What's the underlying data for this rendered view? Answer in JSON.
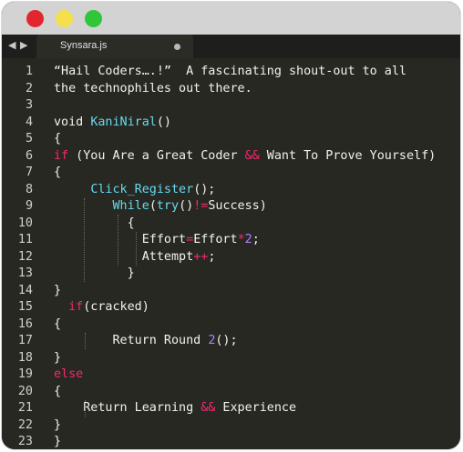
{
  "window": {
    "tab_title": "Synsara.js",
    "nav_back": "◀",
    "nav_forward": "▶",
    "colors": {
      "close": "#e3262e",
      "minimize": "#f5e04b",
      "maximize": "#31c53a",
      "background": "#272822"
    }
  },
  "editor": {
    "lines": [
      {
        "n": "1",
        "parts": [
          [
            "plain",
            "“Hail Coders….!”  A fascinating shout-out to all"
          ]
        ]
      },
      {
        "n": "2",
        "parts": [
          [
            "plain",
            "the technophiles out there."
          ]
        ]
      },
      {
        "n": "3",
        "parts": [
          [
            "plain",
            ""
          ]
        ]
      },
      {
        "n": "4",
        "parts": [
          [
            "plain",
            "void "
          ],
          [
            "fn",
            "KaniNiral"
          ],
          [
            "plain",
            "()"
          ]
        ]
      },
      {
        "n": "5",
        "parts": [
          [
            "plain",
            "{"
          ]
        ]
      },
      {
        "n": "6",
        "parts": [
          [
            "kw",
            "if"
          ],
          [
            "plain",
            " (You Are a Great Coder "
          ],
          [
            "op",
            "&&"
          ],
          [
            "plain",
            " Want To Prove Yourself)"
          ]
        ]
      },
      {
        "n": "7",
        "parts": [
          [
            "plain",
            "{"
          ]
        ]
      },
      {
        "n": "8",
        "parts": [
          [
            "plain",
            "     "
          ],
          [
            "fn",
            "Click_Register"
          ],
          [
            "plain",
            "();"
          ]
        ]
      },
      {
        "n": "9",
        "parts": [
          [
            "plain",
            "        "
          ],
          [
            "fn",
            "While"
          ],
          [
            "plain",
            "("
          ],
          [
            "fn",
            "try"
          ],
          [
            "plain",
            "()"
          ],
          [
            "op",
            "!="
          ],
          [
            "plain",
            "Success)"
          ]
        ]
      },
      {
        "n": "10",
        "parts": [
          [
            "plain",
            "          {"
          ]
        ]
      },
      {
        "n": "11",
        "parts": [
          [
            "plain",
            "            Effort"
          ],
          [
            "op",
            "="
          ],
          [
            "plain",
            "Effort"
          ],
          [
            "op",
            "*"
          ],
          [
            "num",
            "2"
          ],
          [
            "plain",
            ";"
          ]
        ]
      },
      {
        "n": "12",
        "parts": [
          [
            "plain",
            "            Attempt"
          ],
          [
            "op",
            "++"
          ],
          [
            "plain",
            ";"
          ]
        ]
      },
      {
        "n": "13",
        "parts": [
          [
            "plain",
            "          }"
          ]
        ]
      },
      {
        "n": "14",
        "parts": [
          [
            "plain",
            "}"
          ]
        ]
      },
      {
        "n": "15",
        "parts": [
          [
            "plain",
            "  "
          ],
          [
            "kw",
            "if"
          ],
          [
            "plain",
            "(cracked)"
          ]
        ]
      },
      {
        "n": "16",
        "parts": [
          [
            "plain",
            "{"
          ]
        ]
      },
      {
        "n": "17",
        "parts": [
          [
            "plain",
            "        Return Round "
          ],
          [
            "num",
            "2"
          ],
          [
            "plain",
            "();"
          ]
        ]
      },
      {
        "n": "18",
        "parts": [
          [
            "plain",
            "}"
          ]
        ]
      },
      {
        "n": "19",
        "parts": [
          [
            "kw",
            "else"
          ]
        ]
      },
      {
        "n": "20",
        "parts": [
          [
            "plain",
            "{"
          ]
        ]
      },
      {
        "n": "21",
        "parts": [
          [
            "plain",
            "    Return Learning "
          ],
          [
            "op",
            "&&"
          ],
          [
            "plain",
            " Experience"
          ]
        ]
      },
      {
        "n": "22",
        "parts": [
          [
            "plain",
            "}"
          ]
        ]
      },
      {
        "n": "23",
        "parts": [
          [
            "plain",
            "}"
          ]
        ]
      }
    ]
  }
}
